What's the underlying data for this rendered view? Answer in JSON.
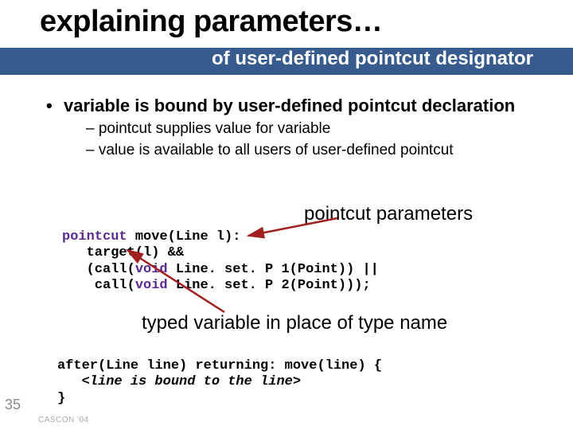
{
  "title": "explaining parameters…",
  "subtitle": "of user-defined pointcut designator",
  "bullet": {
    "dot": "•",
    "text": "variable is bound by user-defined pointcut declaration",
    "sub": [
      "–  pointcut supplies value for variable",
      "–  value is available to all users of user-defined pointcut"
    ]
  },
  "annotation1": "pointcut parameters",
  "code1": {
    "kw1": "pointcut",
    "l1b": " move(Line l):",
    "l2": "   target(l) &&",
    "l3a": "   (call(",
    "kw2": "void",
    "l3b": " Line. set. P 1(Point)) ||",
    "l4a": "    call(",
    "kw3": "void",
    "l4b": " Line. set. P 2(Point)));"
  },
  "annotation2": "typed variable in place of type name",
  "code2": {
    "l1": "after(Line line) returning: move(line) {",
    "l2": "   <line is bound to the line>",
    "l3": "}"
  },
  "slide_number": "35",
  "footer": "CASCON '04"
}
